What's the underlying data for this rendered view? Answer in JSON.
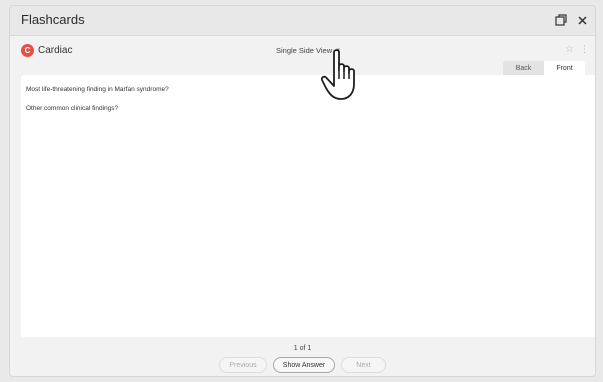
{
  "window": {
    "title": "Flashcards"
  },
  "deck": {
    "initial": "C",
    "name": "Cardiac",
    "accent": "#e2524a"
  },
  "view": {
    "selected": "Single Side View"
  },
  "tabs": {
    "back": "Back",
    "front": "Front"
  },
  "card": {
    "lines": [
      "Most life-threatening finding in Marfan syndrome?",
      "Other common clinical findings?"
    ]
  },
  "pager": {
    "counter": "1 of 1"
  },
  "buttons": {
    "previous": "Previous",
    "show_answer": "Show Answer",
    "next": "Next"
  },
  "icons": [
    "popout-icon",
    "close-icon",
    "star-icon",
    "more-icon",
    "chevron-down-icon",
    "hand-cursor-icon"
  ]
}
